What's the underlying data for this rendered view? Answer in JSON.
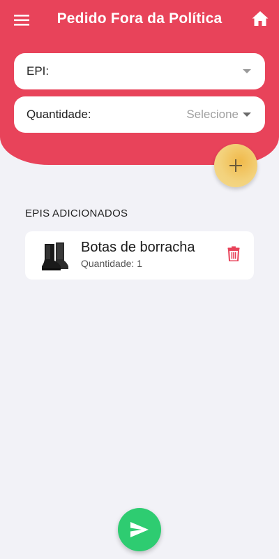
{
  "header": {
    "title": "Pedido Fora da Política",
    "background_color": "#e8435a"
  },
  "form": {
    "epi": {
      "label": "EPI:",
      "value": ""
    },
    "quantidade": {
      "label": "Quantidade:",
      "placeholder": "Selecione"
    }
  },
  "added_section": {
    "title": "EPIS ADICIONADOS",
    "items": [
      {
        "name": "Botas de borracha",
        "quantity_label": "Quantidade:",
        "quantity_value": "1",
        "icon": "boot-image"
      }
    ]
  },
  "actions": {
    "add_button_icon": "plus-icon",
    "send_button_icon": "send-icon",
    "send_color": "#2ecc71",
    "add_color": "#f3d27c",
    "delete_color": "#e8435a"
  }
}
